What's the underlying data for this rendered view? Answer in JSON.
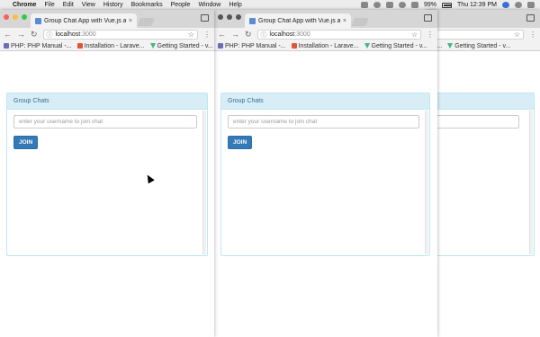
{
  "menubar": {
    "app_name": "Chrome",
    "items": [
      "File",
      "Edit",
      "View",
      "History",
      "Bookmarks",
      "People",
      "Window",
      "Help"
    ],
    "battery": "99%",
    "clock": "Thu 12:39 PM"
  },
  "browser": {
    "tab_title": "Group Chat App with Vue.js a",
    "tab_close": "×",
    "url_host": "localhost",
    "url_port": ":3000",
    "bookmarks": [
      {
        "label": "PHP: PHP Manual -...",
        "icon": "php-icon"
      },
      {
        "label": "Installation - Larave...",
        "icon": "laravel-icon"
      },
      {
        "label": "Getting Started - v...",
        "icon": "vue-icon"
      }
    ],
    "bookmarks_overflow": "»",
    "w3_bookmark_prefix": "ve...",
    "w3_bookmark_vue": "Getting Started - v..."
  },
  "app": {
    "panel_title": "Group Chats",
    "username_placeholder": "enter your username to join chat",
    "join_label": "JOIN"
  },
  "colors": {
    "panel_heading_bg": "#d9edf7",
    "panel_border": "#bce8f1",
    "primary": "#337ab7"
  }
}
